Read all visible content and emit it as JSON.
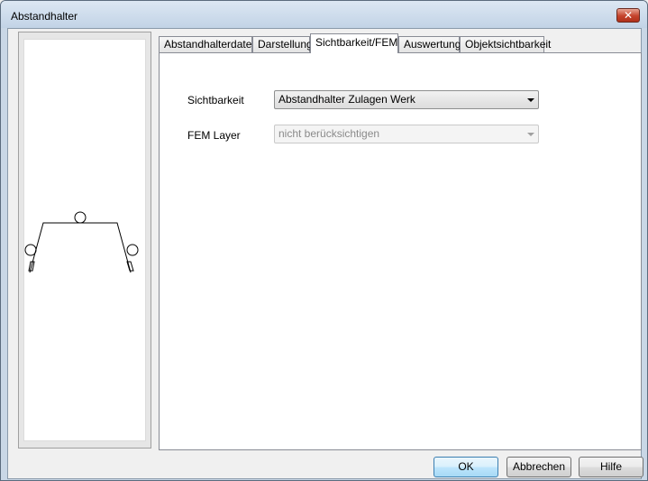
{
  "window": {
    "title": "Abstandhalter"
  },
  "tabs": [
    {
      "label": "Abstandhalterdaten"
    },
    {
      "label": "Darstellung"
    },
    {
      "label": "Sichtbarkeit/FEM"
    },
    {
      "label": "Auswertung"
    },
    {
      "label": "Objektsichtbarkeit"
    }
  ],
  "active_tab": "Sichtbarkeit/FEM",
  "form": {
    "sichtbarkeit": {
      "label": "Sichtbarkeit",
      "value": "Abstandhalter Zulagen Werk"
    },
    "fem_layer": {
      "label": "FEM Layer",
      "value": "nicht berücksichtigen",
      "disabled": true
    }
  },
  "buttons": {
    "ok": "OK",
    "cancel": "Abbrechen",
    "help": "Hilfe"
  },
  "icons": {
    "close": "close-icon"
  }
}
